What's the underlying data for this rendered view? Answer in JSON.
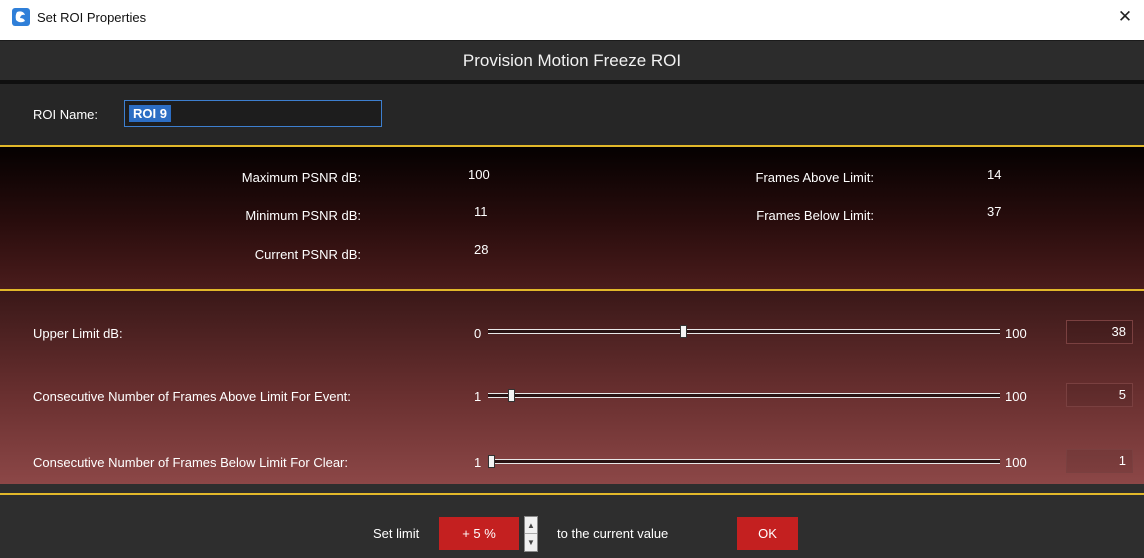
{
  "window": {
    "title": "Set ROI Properties",
    "close_glyph": "✕"
  },
  "header": {
    "title": "Provision Motion Freeze ROI"
  },
  "roi": {
    "name_label": "ROI Name:",
    "name_value": "ROI 9"
  },
  "stats": {
    "max_psnr_label": "Maximum PSNR dB:",
    "max_psnr_value": "100",
    "min_psnr_label": "Minimum PSNR dB:",
    "min_psnr_value": "11",
    "current_psnr_label": "Current PSNR dB:",
    "current_psnr_value": "28",
    "frames_above_label": "Frames Above Limit:",
    "frames_above_value": "14",
    "frames_below_label": "Frames Below Limit:",
    "frames_below_value": "37"
  },
  "limits": {
    "upper": {
      "label": "Upper Limit dB:",
      "min": "0",
      "max": "100",
      "value": "38",
      "fraction": 0.38
    },
    "above": {
      "label": "Consecutive Number of Frames Above Limit For Event:",
      "min": "1",
      "max": "100",
      "value": "5",
      "fraction": 0.04
    },
    "below": {
      "label": "Consecutive Number of Frames Below Limit For Clear:",
      "min": "1",
      "max": "100",
      "value": "1",
      "fraction": 0.0
    }
  },
  "footer": {
    "set_limit_label": "Set limit",
    "percent_value": "+ 5 %",
    "suffix_label": "to the current value",
    "ok_label": "OK"
  },
  "colors": {
    "accent_red": "#c42020",
    "gold": "#e2b82a",
    "selection_blue": "#2c6ec4"
  },
  "icons": {
    "app": "app-logo-icon",
    "close": "close-icon",
    "spin_up": "chevron-up-icon",
    "spin_down": "chevron-down-icon"
  }
}
